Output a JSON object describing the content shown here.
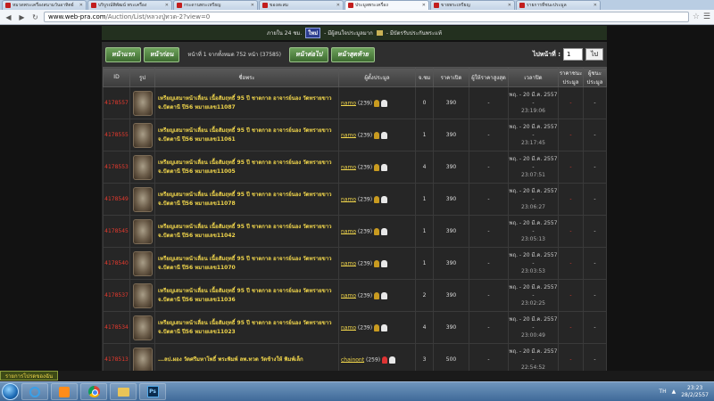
{
  "browser": {
    "tabs": [
      {
        "title": "หมวดพระเครื่องสนามวันอาทิตย์",
        "active": false
      },
      {
        "title": "บริบูรณ์พิพัฒน์ พระเครื่อง",
        "active": false
      },
      {
        "title": "กระดานพระเหรียญ",
        "active": false
      },
      {
        "title": "ของสะสม",
        "active": false
      },
      {
        "title": "ประมูลพระเครื่อง",
        "active": true
      },
      {
        "title": "ขายพระเหรียญ",
        "active": false
      },
      {
        "title": "รายการที่ชนะประมูล",
        "active": false
      }
    ],
    "url_host": "www.web-pra.com",
    "url_path": "/Auction/List/หลวงปู่ทวด-2?view=0"
  },
  "topstrip": {
    "prefix": "ภายใน 24 ชม.",
    "chip": "ใหม่",
    "text1": "- มีผู้สนใจประมูลมาก",
    "text2": "- มีบัตรรับประกันพระแท้"
  },
  "controls": {
    "btn_first": "หน้าแรก",
    "btn_prev": "หน้าก่อน",
    "page_info": "หน้าที่ 1 จากทั้งหมด 752 หน้า (37585)",
    "btn_next": "หน้าต่อไป",
    "btn_last": "หน้าสุดท้าย",
    "goto_label": "ไปหน้าที่ :",
    "goto_value": "1",
    "go_label": "ไป"
  },
  "table": {
    "headers": {
      "id": "ID",
      "image": "รูป",
      "name": "ชื่อพระ",
      "seller": "ผู้ตั้งประมูล",
      "bids": "จ.ชม",
      "start_price": "ราคาเปิด",
      "top_bidder": "ผู้ให้ราคาสูงสุด",
      "time": "เวลาปิด",
      "win_price": "ราคาชนะประมูล",
      "winner": "ผู้ชนะประมูล"
    },
    "rows": [
      {
        "id": "4178557",
        "name": "เหรียญเสมาหน้าเลื่อน เนื้อสัมฤทธิ์ 95 ปี ชาตกาล อาจารย์นอง วัดทรายขาว จ.ปัตตานี ปี56 หมายเลข11087",
        "seller": "namo",
        "score": "(239)",
        "bids": "0",
        "price": "390",
        "top": "-",
        "date": "พฤ. - 20 มี.ค. 2557 -",
        "clock": "23:19:06",
        "win": "-",
        "winner": "-",
        "medal": "gold"
      },
      {
        "id": "4178555",
        "name": "เหรียญเสมาหน้าเลื่อน เนื้อสัมฤทธิ์ 95 ปี ชาตกาล อาจารย์นอง วัดทรายขาว จ.ปัตตานี ปี56 หมายเลข11061",
        "seller": "namo",
        "score": "(239)",
        "bids": "1",
        "price": "390",
        "top": "-",
        "date": "พฤ. - 20 มี.ค. 2557 -",
        "clock": "23:17:45",
        "win": "-",
        "winner": "-",
        "medal": "gold"
      },
      {
        "id": "4178553",
        "name": "เหรียญเสมาหน้าเลื่อน เนื้อสัมฤทธิ์ 95 ปี ชาตกาล อาจารย์นอง วัดทรายขาว จ.ปัตตานี ปี56 หมายเลข11005",
        "seller": "namo",
        "score": "(239)",
        "bids": "4",
        "price": "390",
        "top": "-",
        "date": "พฤ. - 20 มี.ค. 2557 -",
        "clock": "23:07:51",
        "win": "-",
        "winner": "-",
        "medal": "gold"
      },
      {
        "id": "4178549",
        "name": "เหรียญเสมาหน้าเลื่อน เนื้อสัมฤทธิ์ 95 ปี ชาตกาล อาจารย์นอง วัดทรายขาว จ.ปัตตานี ปี56 หมายเลข11078",
        "seller": "namo",
        "score": "(239)",
        "bids": "1",
        "price": "390",
        "top": "-",
        "date": "พฤ. - 20 มี.ค. 2557 -",
        "clock": "23:06:27",
        "win": "-",
        "winner": "-",
        "medal": "gold"
      },
      {
        "id": "4178545",
        "name": "เหรียญเสมาหน้าเลื่อน เนื้อสัมฤทธิ์ 95 ปี ชาตกาล อาจารย์นอง วัดทรายขาว จ.ปัตตานี ปี56 หมายเลข11042",
        "seller": "namo",
        "score": "(239)",
        "bids": "1",
        "price": "390",
        "top": "-",
        "date": "พฤ. - 20 มี.ค. 2557 -",
        "clock": "23:05:13",
        "win": "-",
        "winner": "-",
        "medal": "gold"
      },
      {
        "id": "4178540",
        "name": "เหรียญเสมาหน้าเลื่อน เนื้อสัมฤทธิ์ 95 ปี ชาตกาล อาจารย์นอง วัดทรายขาว จ.ปัตตานี ปี56 หมายเลข11070",
        "seller": "namo",
        "score": "(239)",
        "bids": "1",
        "price": "390",
        "top": "-",
        "date": "พฤ. - 20 มี.ค. 2557 -",
        "clock": "23:03:53",
        "win": "-",
        "winner": "-",
        "medal": "gold"
      },
      {
        "id": "4178537",
        "name": "เหรียญเสมาหน้าเลื่อน เนื้อสัมฤทธิ์ 95 ปี ชาตกาล อาจารย์นอง วัดทรายขาว จ.ปัตตานี ปี56 หมายเลข11036",
        "seller": "namo",
        "score": "(239)",
        "bids": "2",
        "price": "390",
        "top": "-",
        "date": "พฤ. - 20 มี.ค. 2557 -",
        "clock": "23:02:25",
        "win": "-",
        "winner": "-",
        "medal": "gold"
      },
      {
        "id": "4178534",
        "name": "เหรียญเสมาหน้าเลื่อน เนื้อสัมฤทธิ์ 95 ปี ชาตกาล อาจารย์นอง วัดทรายขาว จ.ปัตตานี ปี56 หมายเลข11023",
        "seller": "namo",
        "score": "(239)",
        "bids": "4",
        "price": "390",
        "top": "-",
        "date": "พฤ. - 20 มี.ค. 2557 -",
        "clock": "23:00:49",
        "win": "-",
        "winner": "-",
        "medal": "gold"
      },
      {
        "id": "4178513",
        "name": "...ลป.ผอง วัดศรีมหาโพธิ์ พระพิมพ์ ลพ.ทวด วัดช้างให้ พิมพ์เล็ก",
        "seller": "chainont",
        "score": "(259)",
        "bids": "3",
        "price": "500",
        "top": "-",
        "date": "พฤ. - 20 มี.ค. 2557 -",
        "clock": "22:54:52",
        "win": "-",
        "winner": "-",
        "medal": "red"
      }
    ]
  },
  "footer_tab": "รายการโปรดของฉัน",
  "taskbar": {
    "lang": "TH",
    "time": "23:23",
    "date": "28/2/2557",
    "ps_label": "Ps"
  },
  "colors": {
    "accent_gold": "#f0d54b",
    "id_red": "#e83a2e",
    "button_green": "#4f8a3f"
  }
}
